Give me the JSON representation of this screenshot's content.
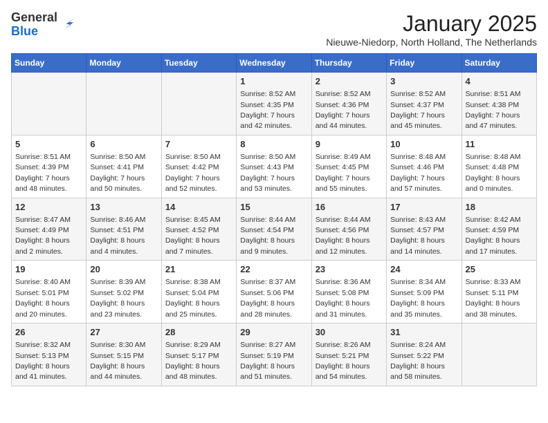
{
  "logo": {
    "general": "General",
    "blue": "Blue"
  },
  "header": {
    "title": "January 2025",
    "subtitle": "Nieuwe-Niedorp, North Holland, The Netherlands"
  },
  "weekdays": [
    "Sunday",
    "Monday",
    "Tuesday",
    "Wednesday",
    "Thursday",
    "Friday",
    "Saturday"
  ],
  "weeks": [
    [
      {
        "day": "",
        "info": ""
      },
      {
        "day": "",
        "info": ""
      },
      {
        "day": "",
        "info": ""
      },
      {
        "day": "1",
        "info": "Sunrise: 8:52 AM\nSunset: 4:35 PM\nDaylight: 7 hours\nand 42 minutes."
      },
      {
        "day": "2",
        "info": "Sunrise: 8:52 AM\nSunset: 4:36 PM\nDaylight: 7 hours\nand 44 minutes."
      },
      {
        "day": "3",
        "info": "Sunrise: 8:52 AM\nSunset: 4:37 PM\nDaylight: 7 hours\nand 45 minutes."
      },
      {
        "day": "4",
        "info": "Sunrise: 8:51 AM\nSunset: 4:38 PM\nDaylight: 7 hours\nand 47 minutes."
      }
    ],
    [
      {
        "day": "5",
        "info": "Sunrise: 8:51 AM\nSunset: 4:39 PM\nDaylight: 7 hours\nand 48 minutes."
      },
      {
        "day": "6",
        "info": "Sunrise: 8:50 AM\nSunset: 4:41 PM\nDaylight: 7 hours\nand 50 minutes."
      },
      {
        "day": "7",
        "info": "Sunrise: 8:50 AM\nSunset: 4:42 PM\nDaylight: 7 hours\nand 52 minutes."
      },
      {
        "day": "8",
        "info": "Sunrise: 8:50 AM\nSunset: 4:43 PM\nDaylight: 7 hours\nand 53 minutes."
      },
      {
        "day": "9",
        "info": "Sunrise: 8:49 AM\nSunset: 4:45 PM\nDaylight: 7 hours\nand 55 minutes."
      },
      {
        "day": "10",
        "info": "Sunrise: 8:48 AM\nSunset: 4:46 PM\nDaylight: 7 hours\nand 57 minutes."
      },
      {
        "day": "11",
        "info": "Sunrise: 8:48 AM\nSunset: 4:48 PM\nDaylight: 8 hours\nand 0 minutes."
      }
    ],
    [
      {
        "day": "12",
        "info": "Sunrise: 8:47 AM\nSunset: 4:49 PM\nDaylight: 8 hours\nand 2 minutes."
      },
      {
        "day": "13",
        "info": "Sunrise: 8:46 AM\nSunset: 4:51 PM\nDaylight: 8 hours\nand 4 minutes."
      },
      {
        "day": "14",
        "info": "Sunrise: 8:45 AM\nSunset: 4:52 PM\nDaylight: 8 hours\nand 7 minutes."
      },
      {
        "day": "15",
        "info": "Sunrise: 8:44 AM\nSunset: 4:54 PM\nDaylight: 8 hours\nand 9 minutes."
      },
      {
        "day": "16",
        "info": "Sunrise: 8:44 AM\nSunset: 4:56 PM\nDaylight: 8 hours\nand 12 minutes."
      },
      {
        "day": "17",
        "info": "Sunrise: 8:43 AM\nSunset: 4:57 PM\nDaylight: 8 hours\nand 14 minutes."
      },
      {
        "day": "18",
        "info": "Sunrise: 8:42 AM\nSunset: 4:59 PM\nDaylight: 8 hours\nand 17 minutes."
      }
    ],
    [
      {
        "day": "19",
        "info": "Sunrise: 8:40 AM\nSunset: 5:01 PM\nDaylight: 8 hours\nand 20 minutes."
      },
      {
        "day": "20",
        "info": "Sunrise: 8:39 AM\nSunset: 5:02 PM\nDaylight: 8 hours\nand 23 minutes."
      },
      {
        "day": "21",
        "info": "Sunrise: 8:38 AM\nSunset: 5:04 PM\nDaylight: 8 hours\nand 25 minutes."
      },
      {
        "day": "22",
        "info": "Sunrise: 8:37 AM\nSunset: 5:06 PM\nDaylight: 8 hours\nand 28 minutes."
      },
      {
        "day": "23",
        "info": "Sunrise: 8:36 AM\nSunset: 5:08 PM\nDaylight: 8 hours\nand 31 minutes."
      },
      {
        "day": "24",
        "info": "Sunrise: 8:34 AM\nSunset: 5:09 PM\nDaylight: 8 hours\nand 35 minutes."
      },
      {
        "day": "25",
        "info": "Sunrise: 8:33 AM\nSunset: 5:11 PM\nDaylight: 8 hours\nand 38 minutes."
      }
    ],
    [
      {
        "day": "26",
        "info": "Sunrise: 8:32 AM\nSunset: 5:13 PM\nDaylight: 8 hours\nand 41 minutes."
      },
      {
        "day": "27",
        "info": "Sunrise: 8:30 AM\nSunset: 5:15 PM\nDaylight: 8 hours\nand 44 minutes."
      },
      {
        "day": "28",
        "info": "Sunrise: 8:29 AM\nSunset: 5:17 PM\nDaylight: 8 hours\nand 48 minutes."
      },
      {
        "day": "29",
        "info": "Sunrise: 8:27 AM\nSunset: 5:19 PM\nDaylight: 8 hours\nand 51 minutes."
      },
      {
        "day": "30",
        "info": "Sunrise: 8:26 AM\nSunset: 5:21 PM\nDaylight: 8 hours\nand 54 minutes."
      },
      {
        "day": "31",
        "info": "Sunrise: 8:24 AM\nSunset: 5:22 PM\nDaylight: 8 hours\nand 58 minutes."
      },
      {
        "day": "",
        "info": ""
      }
    ]
  ]
}
